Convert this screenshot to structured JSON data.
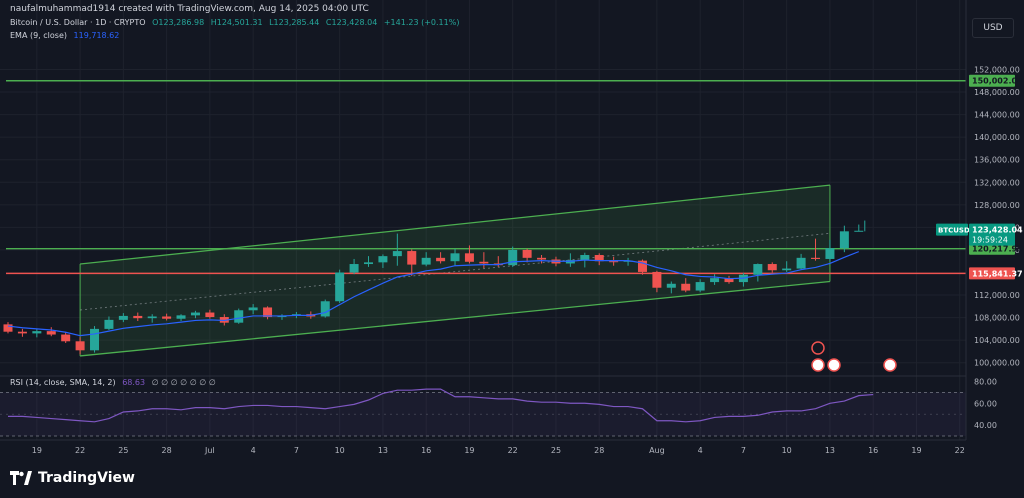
{
  "header": {
    "creator": "naufalmuhammad1914 created with TradingView.com, Aug 14, 2025 04:00 UTC"
  },
  "legend": {
    "symbol": "Bitcoin / U.S. Dollar · 1D · CRYPTO",
    "open": "O123,286.98",
    "high": "H124,501.31",
    "low": "L123,285.44",
    "close": "C123,428.04",
    "change": "+141.23 (+0.11%)",
    "ema_label": "EMA (9, close)",
    "ema_value": "119,718.62",
    "rsi_label": "RSI (14, close, SMA, 14, 2)",
    "rsi_value": "68.63",
    "rsi_na": "∅ ∅ ∅ ∅ ∅ ∅ ∅"
  },
  "currency_button": "USD",
  "brand": "TradingView",
  "colors": {
    "up": "#26a69a",
    "down": "#ef5350",
    "ema": "#2962ff",
    "channel": "#4caf50",
    "rsi": "#7e57c2",
    "resistance": "#4caf50",
    "support": "#ef5350"
  },
  "levels": {
    "top": {
      "value": 150002.04,
      "label": "150,002.04"
    },
    "mid": {
      "value": 120217.99,
      "label": "120,217.99"
    },
    "low": {
      "value": 115841.37,
      "label": "115,841.37"
    },
    "last": {
      "symbol": "BTCUSD",
      "price": "123,428.04",
      "countdown": "19:59:24"
    }
  },
  "chart_data": {
    "type": "candlestick",
    "price_axis": {
      "min": 98000,
      "max": 154000,
      "ticks": [
        100000,
        104000,
        108000,
        112000,
        120000,
        124000,
        128000,
        132000,
        136000,
        140000,
        144000,
        148000,
        152000
      ],
      "tick_labels": [
        "100,000.00",
        "104,000.00",
        "108,000.00",
        "112,000.00",
        "120,000.00",
        "124,000.00",
        "128,000.00",
        "132,000.00",
        "136,000.00",
        "140,000.00",
        "144,000.00",
        "148,000.00",
        "152,000.00"
      ]
    },
    "x_axis": {
      "ticks": [
        {
          "i": 2,
          "label": "19"
        },
        {
          "i": 5,
          "label": "22"
        },
        {
          "i": 8,
          "label": "25"
        },
        {
          "i": 11,
          "label": "28"
        },
        {
          "i": 14,
          "label": "Jul"
        },
        {
          "i": 17,
          "label": "4"
        },
        {
          "i": 20,
          "label": "7"
        },
        {
          "i": 23,
          "label": "10"
        },
        {
          "i": 26,
          "label": "13"
        },
        {
          "i": 29,
          "label": "16"
        },
        {
          "i": 32,
          "label": "19"
        },
        {
          "i": 35,
          "label": "22"
        },
        {
          "i": 38,
          "label": "25"
        },
        {
          "i": 41,
          "label": "28"
        },
        {
          "i": 45,
          "label": "Aug"
        },
        {
          "i": 48,
          "label": "4"
        },
        {
          "i": 51,
          "label": "7"
        },
        {
          "i": 54,
          "label": "10"
        },
        {
          "i": 57,
          "label": "13"
        },
        {
          "i": 60,
          "label": "16"
        },
        {
          "i": 63,
          "label": "19"
        },
        {
          "i": 66,
          "label": "22"
        }
      ]
    },
    "candles": [
      [
        106800,
        107200,
        105200,
        105500
      ],
      [
        105500,
        106000,
        104600,
        105200
      ],
      [
        105200,
        105900,
        104500,
        105600
      ],
      [
        105600,
        106300,
        104700,
        105000
      ],
      [
        105000,
        105400,
        103500,
        103800
      ],
      [
        103800,
        104500,
        101500,
        102200
      ],
      [
        102200,
        106500,
        101800,
        106000
      ],
      [
        106000,
        108200,
        105800,
        107600
      ],
      [
        107600,
        108800,
        107200,
        108300
      ],
      [
        108300,
        108900,
        107400,
        107900
      ],
      [
        107900,
        108600,
        107100,
        108200
      ],
      [
        108200,
        108700,
        107500,
        107800
      ],
      [
        107800,
        108600,
        107400,
        108400
      ],
      [
        108400,
        109200,
        107900,
        108900
      ],
      [
        108900,
        109400,
        107800,
        108100
      ],
      [
        108100,
        108600,
        106600,
        107100
      ],
      [
        107100,
        109600,
        106900,
        109300
      ],
      [
        109300,
        110400,
        108600,
        109800
      ],
      [
        109800,
        110000,
        107700,
        108100
      ],
      [
        108100,
        108600,
        107600,
        108300
      ],
      [
        108300,
        109000,
        107900,
        108600
      ],
      [
        108600,
        109100,
        107800,
        108200
      ],
      [
        108200,
        111200,
        108000,
        110900
      ],
      [
        110900,
        116500,
        110600,
        116000
      ],
      [
        116000,
        118400,
        115700,
        117500
      ],
      [
        117500,
        118900,
        117000,
        117800
      ],
      [
        117800,
        119200,
        116800,
        118900
      ],
      [
        118900,
        122900,
        117200,
        119800
      ],
      [
        119800,
        120100,
        115400,
        117400
      ],
      [
        117400,
        119600,
        117100,
        118600
      ],
      [
        118600,
        119600,
        117600,
        118000
      ],
      [
        118000,
        120200,
        117200,
        119400
      ],
      [
        119400,
        120800,
        117600,
        117900
      ],
      [
        117900,
        119600,
        116800,
        117600
      ],
      [
        117600,
        118900,
        117000,
        117300
      ],
      [
        117300,
        120600,
        117000,
        120000
      ],
      [
        120000,
        120200,
        117800,
        118600
      ],
      [
        118600,
        119100,
        117600,
        118300
      ],
      [
        118300,
        118800,
        117100,
        117600
      ],
      [
        117600,
        119400,
        117000,
        118200
      ],
      [
        118200,
        119500,
        116900,
        119100
      ],
      [
        119100,
        119400,
        117300,
        118000
      ],
      [
        118000,
        118800,
        117200,
        117900
      ],
      [
        117900,
        118600,
        117200,
        118100
      ],
      [
        118100,
        118300,
        115600,
        116100
      ],
      [
        116100,
        116300,
        112500,
        113300
      ],
      [
        113300,
        114400,
        112300,
        114000
      ],
      [
        114000,
        115000,
        112500,
        112800
      ],
      [
        112800,
        114800,
        112500,
        114300
      ],
      [
        114300,
        115700,
        113800,
        115000
      ],
      [
        115000,
        115400,
        114000,
        114300
      ],
      [
        114300,
        115900,
        113500,
        115600
      ],
      [
        115600,
        117600,
        114400,
        117500
      ],
      [
        117500,
        117800,
        116000,
        116400
      ],
      [
        116400,
        118000,
        116100,
        116700
      ],
      [
        116700,
        119300,
        116500,
        118600
      ],
      [
        118600,
        122000,
        118100,
        118400
      ],
      [
        118400,
        121800,
        118000,
        120300
      ],
      [
        120300,
        124300,
        119600,
        123300
      ],
      [
        123300,
        124500,
        123300,
        123400
      ]
    ],
    "ema": [
      106500,
      106200,
      106000,
      105800,
      105400,
      104800,
      105100,
      105600,
      106100,
      106400,
      106700,
      106900,
      107200,
      107500,
      107600,
      107500,
      107900,
      108300,
      108300,
      108300,
      108400,
      108400,
      108900,
      110300,
      111700,
      112900,
      114100,
      115200,
      115700,
      116300,
      116600,
      117200,
      117300,
      117400,
      117400,
      117900,
      118000,
      118100,
      118000,
      118000,
      118200,
      118100,
      118100,
      118100,
      117700,
      116900,
      116300,
      115600,
      115300,
      115200,
      114900,
      115000,
      115500,
      115700,
      115900,
      116500,
      116900,
      117600,
      118700,
      119700
    ],
    "channel": {
      "upper": [
        [
          5,
          117500
        ],
        [
          57,
          131500
        ]
      ],
      "lower": [
        [
          5,
          101200
        ],
        [
          57,
          114400
        ]
      ]
    },
    "rsi": {
      "axis_ticks": [
        40,
        60,
        80
      ],
      "values": [
        48,
        48,
        47,
        46,
        45,
        44,
        43,
        46,
        52,
        53,
        55,
        55,
        54,
        56,
        56,
        55,
        57,
        58,
        58,
        57,
        57,
        56,
        55,
        57,
        59,
        63,
        69,
        72,
        72,
        73,
        73,
        66,
        66,
        65,
        64,
        64,
        62,
        61,
        61,
        60,
        60,
        59,
        57,
        57,
        55,
        44,
        44,
        43,
        44,
        47,
        48,
        48,
        49,
        52,
        53,
        53,
        55,
        60,
        62,
        67,
        68
      ]
    },
    "event_icons": {
      "count": 4
    }
  }
}
